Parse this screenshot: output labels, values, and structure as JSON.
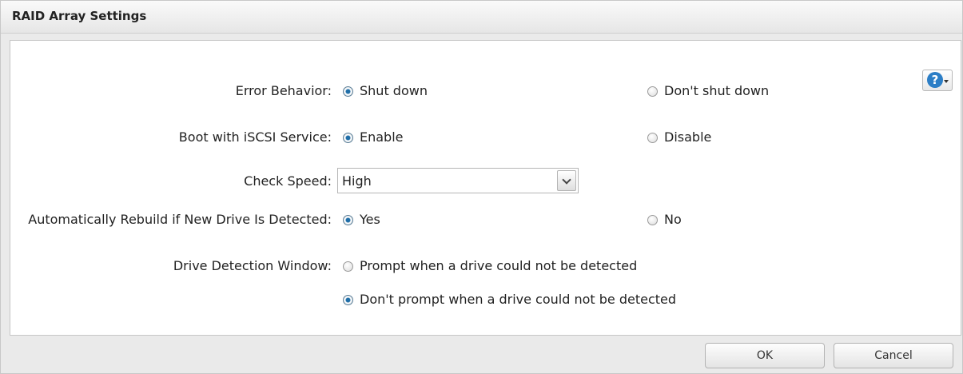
{
  "dialog": {
    "title": "RAID Array Settings"
  },
  "help": {
    "icon": "question-mark-icon",
    "glyph": "?"
  },
  "rows": {
    "error_behavior": {
      "label": "Error Behavior:",
      "options": [
        {
          "label": "Shut down",
          "checked": true
        },
        {
          "label": "Don't shut down",
          "checked": false
        }
      ]
    },
    "boot_iscsi": {
      "label": "Boot with iSCSI Service:",
      "options": [
        {
          "label": "Enable",
          "checked": true
        },
        {
          "label": "Disable",
          "checked": false
        }
      ]
    },
    "check_speed": {
      "label": "Check Speed:",
      "value": "High"
    },
    "auto_rebuild": {
      "label": "Automatically Rebuild if New Drive Is Detected:",
      "options": [
        {
          "label": "Yes",
          "checked": true
        },
        {
          "label": "No",
          "checked": false
        }
      ]
    },
    "drive_detection": {
      "label": "Drive Detection Window:",
      "options": [
        {
          "label": "Prompt when a drive could not be detected",
          "checked": false
        },
        {
          "label": "Don't prompt when a drive could not be detected",
          "checked": true
        }
      ]
    }
  },
  "buttons": {
    "ok": "OK",
    "cancel": "Cancel"
  },
  "colors": {
    "accent": "#1f6ea8",
    "help_icon": "#2c7ec6"
  }
}
